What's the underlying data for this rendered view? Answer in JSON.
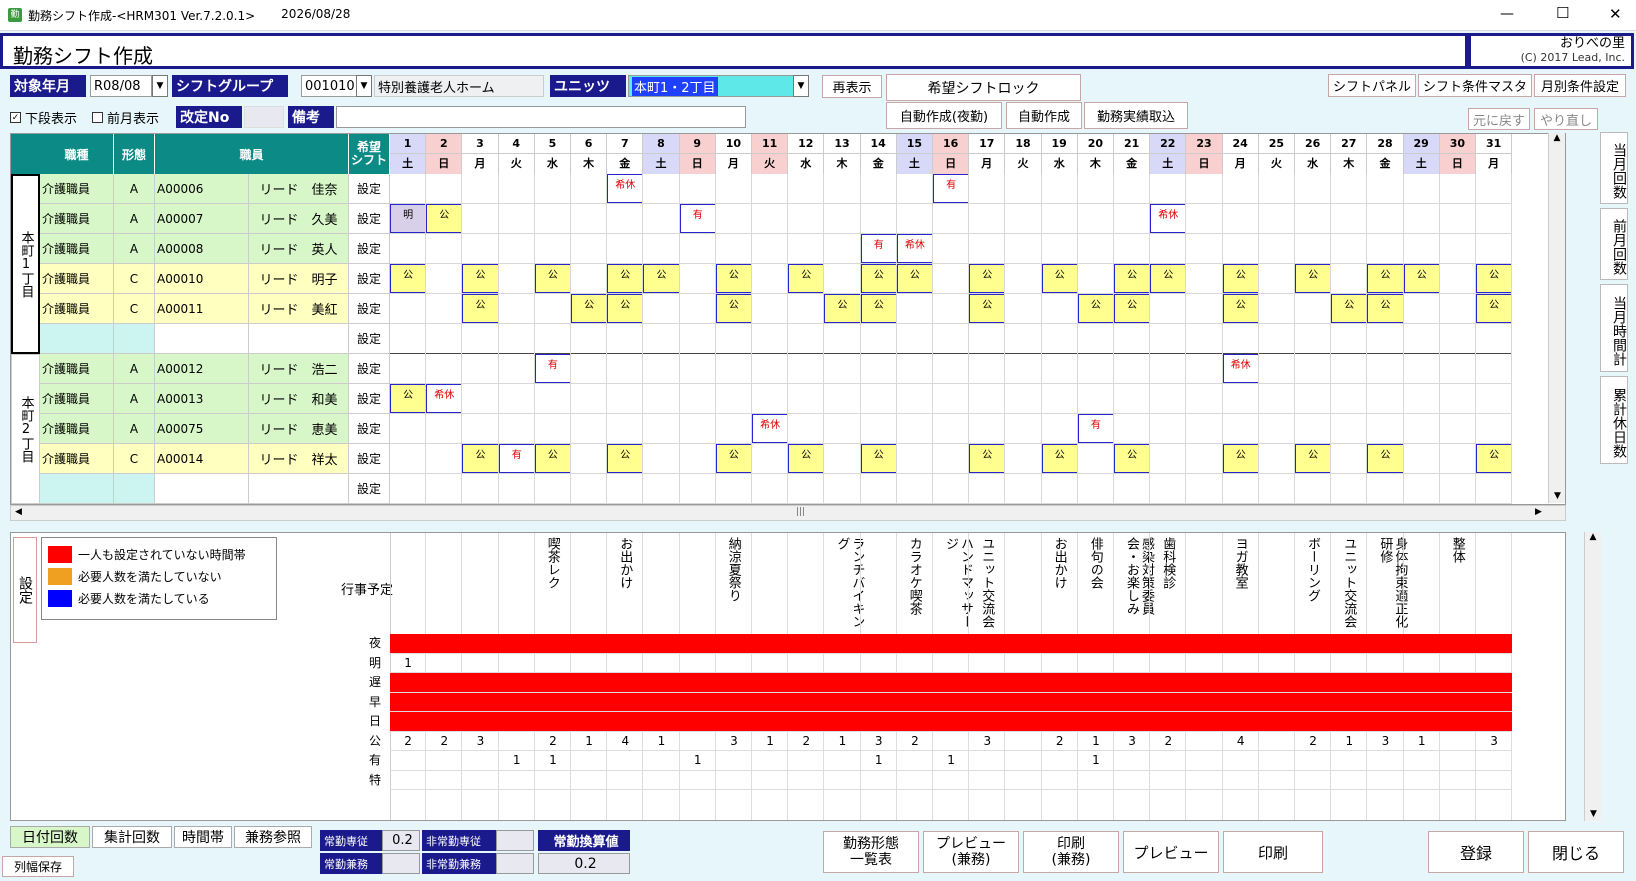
{
  "window": {
    "title": "勤務シフト作成-<HRM301 Ver.7.2.0.1>",
    "date": "2026/08/28",
    "controls": {
      "minimize": "—",
      "maximize": "☐",
      "close": "✕"
    }
  },
  "header": {
    "title": "勤務シフト作成",
    "company": "おりべの里",
    "copyright": "(C) 2017 Lead, Inc."
  },
  "filters": {
    "year_month_label": "対象年月",
    "year_month_value": "R08/08",
    "shift_group_label": "シフトグループ",
    "shift_group_code": "001010",
    "shift_group_name": "特別養護老人ホーム",
    "unit_label": "ユニッツ",
    "unit_value": "本町1・2丁目",
    "refresh": "再表示",
    "lower_display": "下段表示",
    "prev_month_display": "前月表示",
    "revision_label": "改定No",
    "revision_value": "",
    "memo_label": "備考",
    "memo_value": ""
  },
  "actions": {
    "wish_lock": "希望シフトロック",
    "auto_night": "自動作成(夜勤)",
    "auto_create": "自動作成",
    "import_actual": "勤務実績取込",
    "shift_panel": "シフトパネル",
    "shift_master": "シフト条件マスタ",
    "monthly_cond": "月別条件設定",
    "undo": "元に戻す",
    "redo": "やり直し"
  },
  "columns": {
    "job": "職種",
    "type": "形態",
    "staff": "職員",
    "wish": "希望\nシフト",
    "setting": "設定"
  },
  "days": [
    {
      "n": "1",
      "w": "土",
      "k": "sat"
    },
    {
      "n": "2",
      "w": "日",
      "k": "sun"
    },
    {
      "n": "3",
      "w": "月",
      "k": ""
    },
    {
      "n": "4",
      "w": "火",
      "k": ""
    },
    {
      "n": "5",
      "w": "水",
      "k": ""
    },
    {
      "n": "6",
      "w": "木",
      "k": ""
    },
    {
      "n": "7",
      "w": "金",
      "k": ""
    },
    {
      "n": "8",
      "w": "土",
      "k": "sat"
    },
    {
      "n": "9",
      "w": "日",
      "k": "sun"
    },
    {
      "n": "10",
      "w": "月",
      "k": ""
    },
    {
      "n": "11",
      "w": "火",
      "k": "sun"
    },
    {
      "n": "12",
      "w": "水",
      "k": ""
    },
    {
      "n": "13",
      "w": "木",
      "k": ""
    },
    {
      "n": "14",
      "w": "金",
      "k": ""
    },
    {
      "n": "15",
      "w": "土",
      "k": "sat"
    },
    {
      "n": "16",
      "w": "日",
      "k": "sun"
    },
    {
      "n": "17",
      "w": "月",
      "k": ""
    },
    {
      "n": "18",
      "w": "火",
      "k": ""
    },
    {
      "n": "19",
      "w": "水",
      "k": ""
    },
    {
      "n": "20",
      "w": "木",
      "k": ""
    },
    {
      "n": "21",
      "w": "金",
      "k": ""
    },
    {
      "n": "22",
      "w": "土",
      "k": "sat"
    },
    {
      "n": "23",
      "w": "日",
      "k": "sun"
    },
    {
      "n": "24",
      "w": "月",
      "k": ""
    },
    {
      "n": "25",
      "w": "火",
      "k": ""
    },
    {
      "n": "26",
      "w": "水",
      "k": ""
    },
    {
      "n": "27",
      "w": "木",
      "k": ""
    },
    {
      "n": "28",
      "w": "金",
      "k": ""
    },
    {
      "n": "29",
      "w": "土",
      "k": "sat"
    },
    {
      "n": "30",
      "w": "日",
      "k": "sun"
    },
    {
      "n": "31",
      "w": "月",
      "k": ""
    }
  ],
  "groups": [
    {
      "name": "本町1丁目",
      "rows": 6
    },
    {
      "name": "本町2丁目",
      "rows": 5
    }
  ],
  "staff": [
    {
      "job": "介護職員",
      "type": "A",
      "code": "A00006",
      "name": "リード　佳奈",
      "c": "g",
      "marks": [
        [
          7,
          "希休",
          "w"
        ],
        [
          16,
          "有",
          "w"
        ]
      ]
    },
    {
      "job": "介護職員",
      "type": "A",
      "code": "A00007",
      "name": "リード　久美",
      "c": "g",
      "marks": [
        [
          1,
          "明",
          "p"
        ],
        [
          2,
          "公",
          "y"
        ],
        [
          9,
          "有",
          "w"
        ],
        [
          22,
          "希休",
          "w"
        ]
      ]
    },
    {
      "job": "介護職員",
      "type": "A",
      "code": "A00008",
      "name": "リード　英人",
      "c": "g",
      "marks": [
        [
          14,
          "有",
          "w"
        ],
        [
          15,
          "希休",
          "w"
        ]
      ]
    },
    {
      "job": "介護職員",
      "type": "C",
      "code": "A00010",
      "name": "リード　明子",
      "c": "y",
      "marks": [
        [
          1,
          "公",
          "y"
        ],
        [
          3,
          "公",
          "y"
        ],
        [
          5,
          "公",
          "y"
        ],
        [
          7,
          "公",
          "y"
        ],
        [
          8,
          "公",
          "y"
        ],
        [
          10,
          "公",
          "y"
        ],
        [
          12,
          "公",
          "y"
        ],
        [
          14,
          "公",
          "y"
        ],
        [
          15,
          "公",
          "y"
        ],
        [
          17,
          "公",
          "y"
        ],
        [
          19,
          "公",
          "y"
        ],
        [
          21,
          "公",
          "y"
        ],
        [
          22,
          "公",
          "y"
        ],
        [
          24,
          "公",
          "y"
        ],
        [
          26,
          "公",
          "y"
        ],
        [
          28,
          "公",
          "y"
        ],
        [
          29,
          "公",
          "y"
        ],
        [
          31,
          "公",
          "y"
        ]
      ]
    },
    {
      "job": "介護職員",
      "type": "C",
      "code": "A00011",
      "name": "リード　美紅",
      "c": "y",
      "marks": [
        [
          3,
          "公",
          "y"
        ],
        [
          6,
          "公",
          "y"
        ],
        [
          7,
          "公",
          "y"
        ],
        [
          10,
          "公",
          "y"
        ],
        [
          13,
          "公",
          "y"
        ],
        [
          14,
          "公",
          "y"
        ],
        [
          17,
          "公",
          "y"
        ],
        [
          20,
          "公",
          "y"
        ],
        [
          21,
          "公",
          "y"
        ],
        [
          24,
          "公",
          "y"
        ],
        [
          27,
          "公",
          "y"
        ],
        [
          28,
          "公",
          "y"
        ],
        [
          31,
          "公",
          "y"
        ]
      ]
    },
    {
      "job": "",
      "type": "",
      "code": "",
      "name": "",
      "c": "w",
      "marks": []
    },
    {
      "job": "介護職員",
      "type": "A",
      "code": "A00012",
      "name": "リード　浩二",
      "c": "g",
      "marks": [
        [
          5,
          "有",
          "w"
        ],
        [
          24,
          "希休",
          "w"
        ]
      ]
    },
    {
      "job": "介護職員",
      "type": "A",
      "code": "A00013",
      "name": "リード　和美",
      "c": "g",
      "marks": [
        [
          1,
          "公",
          "y"
        ],
        [
          2,
          "希休",
          "w"
        ]
      ]
    },
    {
      "job": "介護職員",
      "type": "A",
      "code": "A00075",
      "name": "リード　恵美",
      "c": "g",
      "marks": [
        [
          11,
          "希休",
          "w"
        ],
        [
          20,
          "有",
          "w"
        ]
      ]
    },
    {
      "job": "介護職員",
      "type": "C",
      "code": "A00014",
      "name": "リード　祥太",
      "c": "y",
      "marks": [
        [
          3,
          "公",
          "y"
        ],
        [
          4,
          "有",
          "w"
        ],
        [
          5,
          "公",
          "y"
        ],
        [
          7,
          "公",
          "y"
        ],
        [
          10,
          "公",
          "y"
        ],
        [
          12,
          "公",
          "y"
        ],
        [
          14,
          "公",
          "y"
        ],
        [
          17,
          "公",
          "y"
        ],
        [
          19,
          "公",
          "y"
        ],
        [
          21,
          "公",
          "y"
        ],
        [
          24,
          "公",
          "y"
        ],
        [
          26,
          "公",
          "y"
        ],
        [
          28,
          "公",
          "y"
        ],
        [
          31,
          "公",
          "y"
        ]
      ]
    },
    {
      "job": "",
      "type": "",
      "code": "",
      "name": "",
      "c": "w",
      "marks": []
    }
  ],
  "legend": {
    "button": "設定",
    "items": [
      {
        "color": "#ff0000",
        "label": "一人も設定されていない時間帯"
      },
      {
        "color": "#f0a020",
        "label": "必要人数を満たしていない"
      },
      {
        "color": "#0000ff",
        "label": "必要人数を満たしている"
      }
    ]
  },
  "events": {
    "label": "行事予定",
    "items": [
      [
        5,
        "喫茶レク"
      ],
      [
        7,
        "お出かけ"
      ],
      [
        10,
        "納涼夏祭り"
      ],
      [
        13,
        "ランチバイキング"
      ],
      [
        15,
        "カラオケ喫茶"
      ],
      [
        16,
        "ハンドマッサージ"
      ],
      [
        17,
        "ユニット交流会"
      ],
      [
        19,
        "お出かけ"
      ],
      [
        20,
        "俳句の会"
      ],
      [
        21,
        "感染対策委員会・お楽しみ"
      ],
      [
        22,
        "歯科検診"
      ],
      [
        24,
        "ヨガ教室"
      ],
      [
        26,
        "ボーリング"
      ],
      [
        27,
        "ユニット交流会"
      ],
      [
        28,
        "身体拘束適正化研修"
      ],
      [
        30,
        "整体"
      ]
    ]
  },
  "summary_rows": [
    {
      "label": "夜",
      "red": true,
      "vals": {}
    },
    {
      "label": "明",
      "red": false,
      "vals": {
        "1": "1"
      }
    },
    {
      "label": "遅",
      "red": true,
      "vals": {}
    },
    {
      "label": "早",
      "red": true,
      "vals": {}
    },
    {
      "label": "日",
      "red": true,
      "vals": {}
    },
    {
      "label": "公",
      "red": false,
      "vals": {
        "1": "2",
        "2": "2",
        "3": "3",
        "5": "2",
        "6": "1",
        "7": "4",
        "8": "1",
        "10": "3",
        "11": "1",
        "12": "2",
        "13": "1",
        "14": "3",
        "15": "2",
        "17": "3",
        "19": "2",
        "20": "1",
        "21": "3",
        "22": "2",
        "24": "4",
        "26": "2",
        "27": "1",
        "28": "3",
        "29": "1",
        "31": "3"
      }
    },
    {
      "label": "有",
      "red": false,
      "vals": {
        "4": "1",
        "5": "1",
        "9": "1",
        "14": "1",
        "16": "1",
        "20": "1"
      }
    },
    {
      "label": "特",
      "red": false,
      "vals": {}
    }
  ],
  "side": {
    "b1": "当月回数",
    "b2": "前月回数",
    "b3": "当月時間計",
    "b4": "累計休日数"
  },
  "bottom": {
    "tab1": "日付回数",
    "tab2": "集計回数",
    "tab3": "時間帯",
    "tab4": "兼務参照",
    "save_width": "列幅保存",
    "l1": "常勤専従",
    "v1": "0.2",
    "l2": "非常勤専従",
    "v2": "",
    "l3": "常勤兼務",
    "v3": "",
    "l4": "非常勤兼務",
    "v4": "",
    "fte_label": "常勤換算値",
    "fte_value": "0.2",
    "b_list": "勤務形態\n一覧表",
    "b_prev2": "プレビュー\n(兼務)",
    "b_print2": "印刷\n(兼務)",
    "b_prev": "プレビュー",
    "b_print": "印刷",
    "b_save": "登録",
    "b_close": "閉じる"
  },
  "colors": {
    "navy": "#1a1a8c",
    "teal": "#0b8a86",
    "green": "#d8f7c8",
    "yellow": "#ffffc0",
    "red": "#ff0000",
    "sat": "#d8d8f8",
    "sun": "#f8d0d0"
  }
}
